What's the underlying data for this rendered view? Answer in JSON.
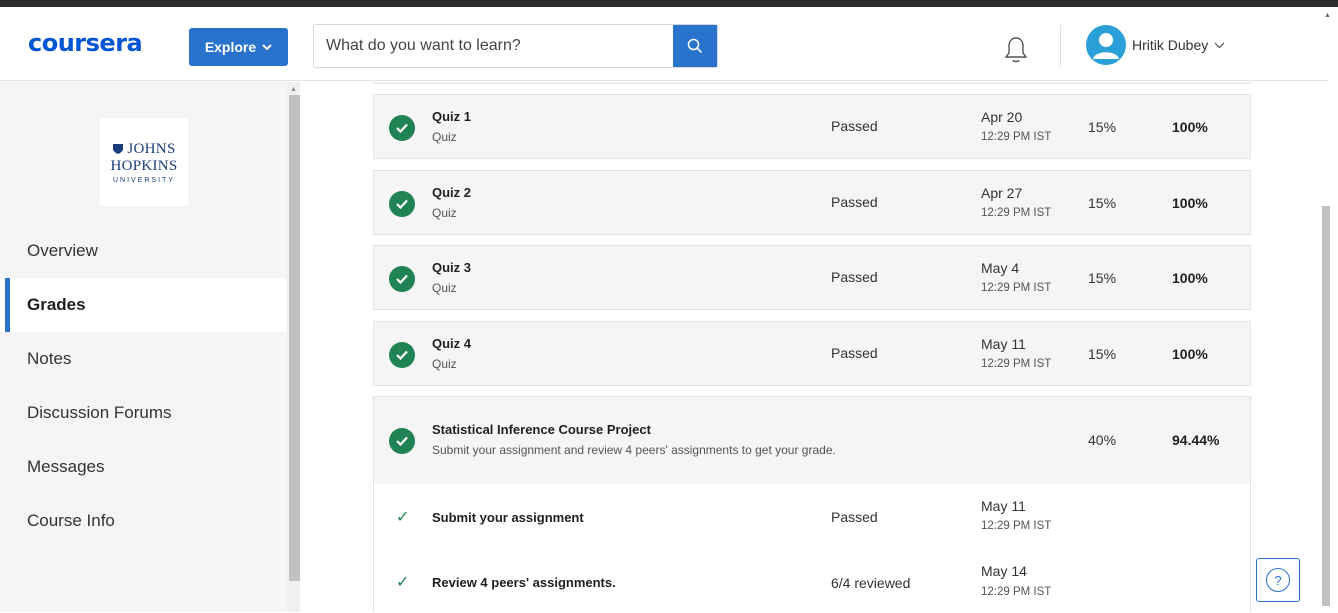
{
  "header": {
    "logo_text": "coursera",
    "explore_label": "Explore",
    "search_placeholder": "What do you want to learn?",
    "user_name": "Hritik Dubey"
  },
  "sidebar": {
    "university": {
      "line1": "JOHNS",
      "line2": "HOPKINS",
      "line3": "UNIVERSITY"
    },
    "items": [
      {
        "label": "Overview"
      },
      {
        "label": "Grades"
      },
      {
        "label": "Notes"
      },
      {
        "label": "Discussion Forums"
      },
      {
        "label": "Messages"
      },
      {
        "label": "Course Info"
      }
    ]
  },
  "grades": {
    "quizzes": [
      {
        "title": "Quiz 1",
        "type": "Quiz",
        "status": "Passed",
        "date": "Apr 20",
        "time": "12:29 PM IST",
        "weight": "15%",
        "grade": "100%"
      },
      {
        "title": "Quiz 2",
        "type": "Quiz",
        "status": "Passed",
        "date": "Apr 27",
        "time": "12:29 PM IST",
        "weight": "15%",
        "grade": "100%"
      },
      {
        "title": "Quiz 3",
        "type": "Quiz",
        "status": "Passed",
        "date": "May 4",
        "time": "12:29 PM IST",
        "weight": "15%",
        "grade": "100%"
      },
      {
        "title": "Quiz 4",
        "type": "Quiz",
        "status": "Passed",
        "date": "May 11",
        "time": "12:29 PM IST",
        "weight": "15%",
        "grade": "100%"
      }
    ],
    "project": {
      "title": "Statistical Inference Course Project",
      "description": "Submit your assignment and review 4 peers' assignments to get your grade.",
      "weight": "40%",
      "grade": "94.44%",
      "subtasks": [
        {
          "title": "Submit your assignment",
          "status": "Passed",
          "date": "May 11",
          "time": "12:29 PM IST"
        },
        {
          "title": "Review 4 peers' assignments.",
          "status": "6/4 reviewed",
          "date": "May 14",
          "time": "12:29 PM IST"
        }
      ]
    }
  },
  "help": {
    "label": "?"
  },
  "colors": {
    "brand": "#0056d2",
    "button": "#2a73cc",
    "success": "#1f8354"
  }
}
